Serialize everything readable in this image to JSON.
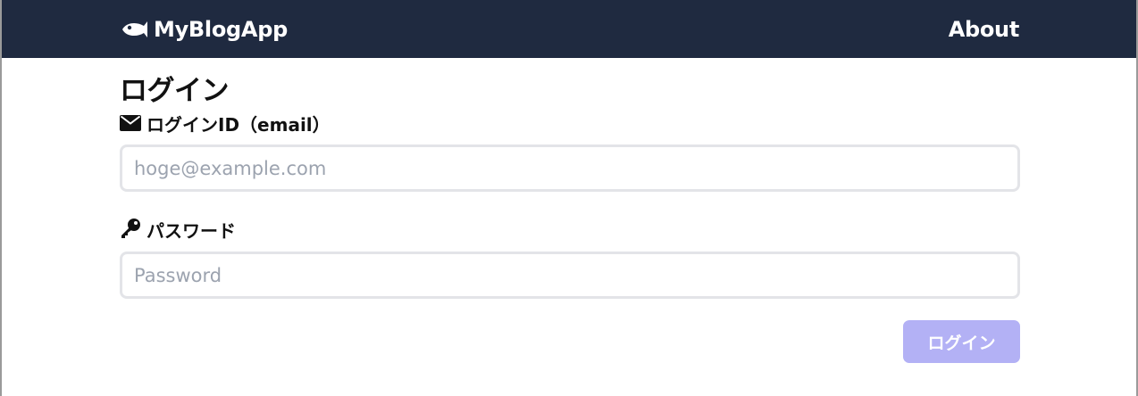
{
  "navbar": {
    "brand_icon": "fish-icon",
    "brand_label": "MyBlogApp",
    "about_label": "About",
    "background_color": "#1f2a40"
  },
  "login_form": {
    "title": "ログイン",
    "email": {
      "icon": "envelope-icon",
      "label": "ログインID（email）",
      "placeholder": "hoge@example.com",
      "value": ""
    },
    "password": {
      "icon": "key-icon",
      "label": "パスワード",
      "placeholder": "Password",
      "value": ""
    },
    "submit_label": "ログイン",
    "submit_color": "#b3b1f5"
  }
}
